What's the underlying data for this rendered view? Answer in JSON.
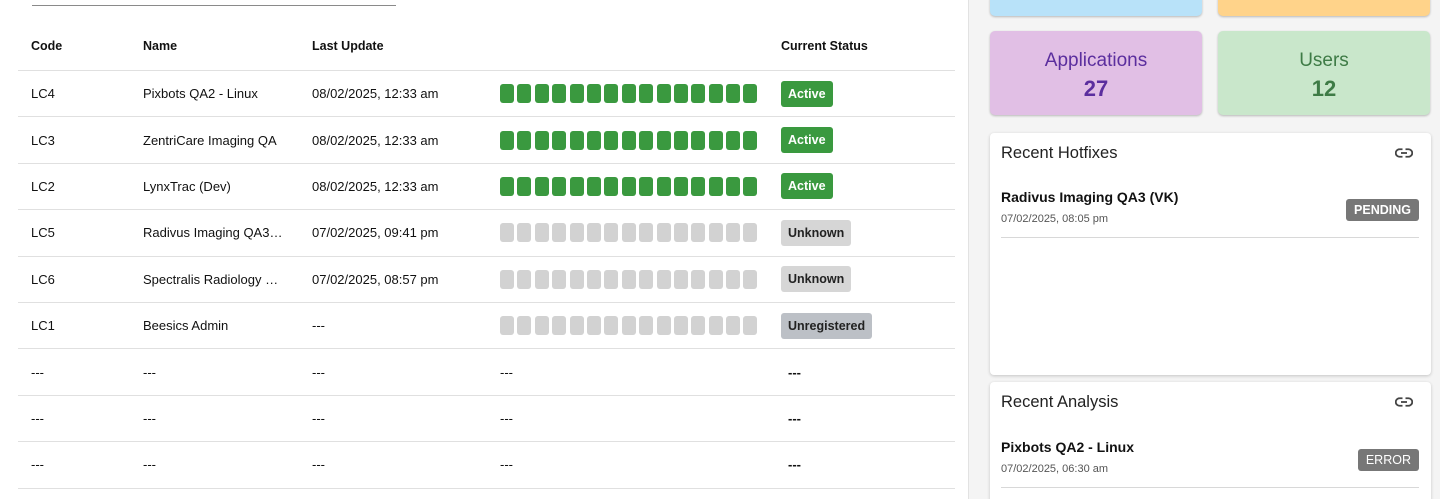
{
  "table": {
    "headers": {
      "code": "Code",
      "name": "Name",
      "last_update": "Last Update",
      "status": "Current Status"
    },
    "rows": [
      {
        "code": "LC4",
        "name": "Pixbots QA2 - Linux",
        "last_update": "08/02/2025, 12:33 am",
        "status": "Active",
        "state": "active",
        "active_bars": 15
      },
      {
        "code": "LC3",
        "name": "ZentriCare Imaging QA",
        "last_update": "08/02/2025, 12:33 am",
        "status": "Active",
        "state": "active",
        "active_bars": 15
      },
      {
        "code": "LC2",
        "name": "LynxTrac (Dev)",
        "last_update": "08/02/2025, 12:33 am",
        "status": "Active",
        "state": "active",
        "active_bars": 15
      },
      {
        "code": "LC5",
        "name": "Radivus Imaging QA3…",
        "last_update": "07/02/2025, 09:41 pm",
        "status": "Unknown",
        "state": "unknown",
        "active_bars": 0
      },
      {
        "code": "LC6",
        "name": "Spectralis Radiology …",
        "last_update": "07/02/2025, 08:57 pm",
        "status": "Unknown",
        "state": "unknown",
        "active_bars": 0
      },
      {
        "code": "LC1",
        "name": "Beesics Admin",
        "last_update": "---",
        "status": "Unregistered",
        "state": "unregistered",
        "active_bars": 0
      },
      {
        "code": "---",
        "name": "---",
        "last_update": "---",
        "bars_text": "---",
        "status": "---",
        "state": "empty"
      },
      {
        "code": "---",
        "name": "---",
        "last_update": "---",
        "bars_text": "---",
        "status": "---",
        "state": "empty"
      },
      {
        "code": "---",
        "name": "---",
        "last_update": "---",
        "bars_text": "---",
        "status": "---",
        "state": "empty"
      }
    ],
    "bar_count": 15
  },
  "stats": {
    "applications": {
      "label": "Applications",
      "value": "27"
    },
    "users": {
      "label": "Users",
      "value": "12"
    }
  },
  "hotfixes": {
    "title": "Recent Hotfixes",
    "items": [
      {
        "name": "Radivus Imaging QA3 (VK)",
        "time": "07/02/2025, 08:05 pm",
        "status": "PENDING"
      }
    ]
  },
  "analysis": {
    "title": "Recent Analysis",
    "items": [
      {
        "name": "Pixbots QA2 - Linux",
        "time": "07/02/2025, 06:30 am",
        "status": "ERROR"
      }
    ]
  },
  "colors": {
    "active": "#3a993f",
    "inactive_bar": "#d2d2d2",
    "applications_bg": "#e1bfe5",
    "users_bg": "#c9e7cb"
  }
}
